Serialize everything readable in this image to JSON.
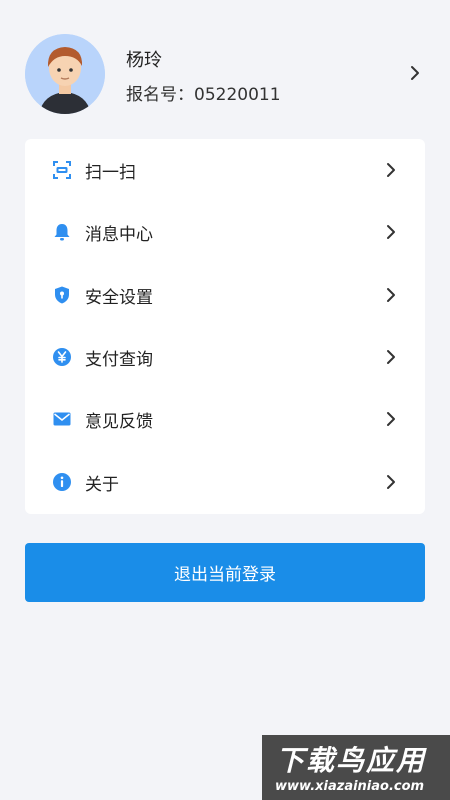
{
  "profile": {
    "name": "杨玲",
    "registration": "报名号：05220011",
    "avatar_icon": "user-avatar-icon",
    "chevron_icon": "chevron-right-icon"
  },
  "menu": {
    "items": [
      {
        "label": "扫一扫",
        "icon": "scan-icon",
        "icon_color": "#2f8ff0"
      },
      {
        "label": "消息中心",
        "icon": "bell-icon",
        "icon_color": "#2f8ff0"
      },
      {
        "label": "安全设置",
        "icon": "shield-icon",
        "icon_color": "#2f8ff0"
      },
      {
        "label": "支付查询",
        "icon": "yen-icon",
        "icon_color": "#2f8ff0"
      },
      {
        "label": "意见反馈",
        "icon": "mail-icon",
        "icon_color": "#2f8ff0"
      },
      {
        "label": "关于",
        "icon": "info-icon",
        "icon_color": "#2f8ff0"
      }
    ]
  },
  "actions": {
    "logout_label": "退出当前登录"
  },
  "watermark": {
    "title": "下载鸟应用",
    "url": "www.xiazainiao.com"
  },
  "colors": {
    "accent": "#1a8de8",
    "background": "#f3f4f8",
    "card": "#ffffff"
  }
}
